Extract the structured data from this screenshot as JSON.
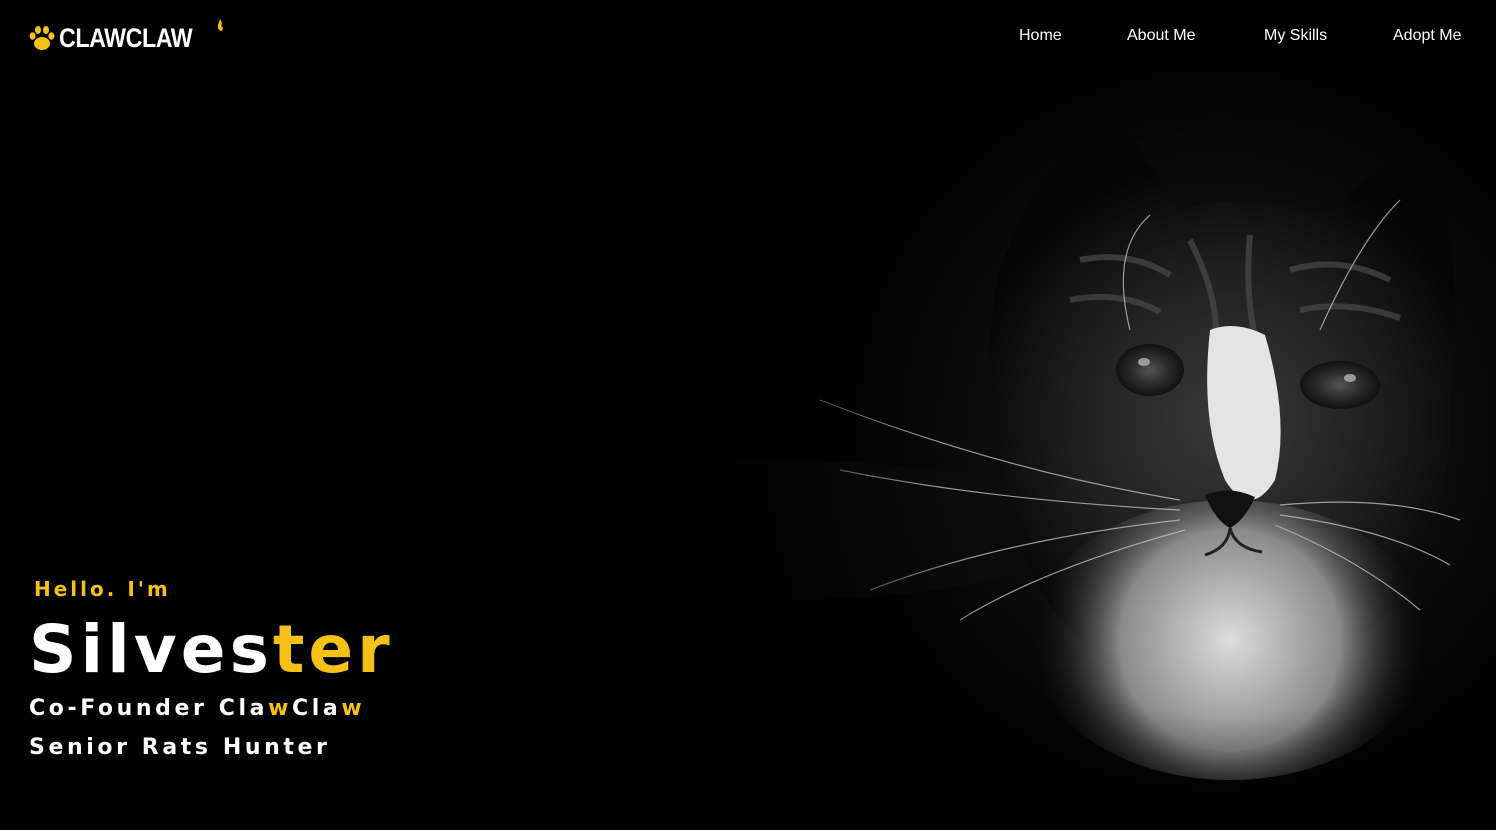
{
  "header": {
    "logo_text": "CLAWCLAW",
    "logo_icon": "paw-icon",
    "nav": [
      {
        "label": "Home"
      },
      {
        "label": "About Me"
      },
      {
        "label": "My Skills"
      },
      {
        "label": "Adopt Me"
      }
    ]
  },
  "hero": {
    "greeting": "Hello. I'm",
    "name_main": "Silves",
    "name_accent": "ter",
    "role_line1_a": "Co-Founder Cla",
    "role_line1_b": "w",
    "role_line1_c": "Cla",
    "role_line1_d": "w",
    "role_line2": "Senior Rats Hunter"
  },
  "colors": {
    "background": "#000000",
    "accent": "#f5c116",
    "text": "#ffffff"
  }
}
